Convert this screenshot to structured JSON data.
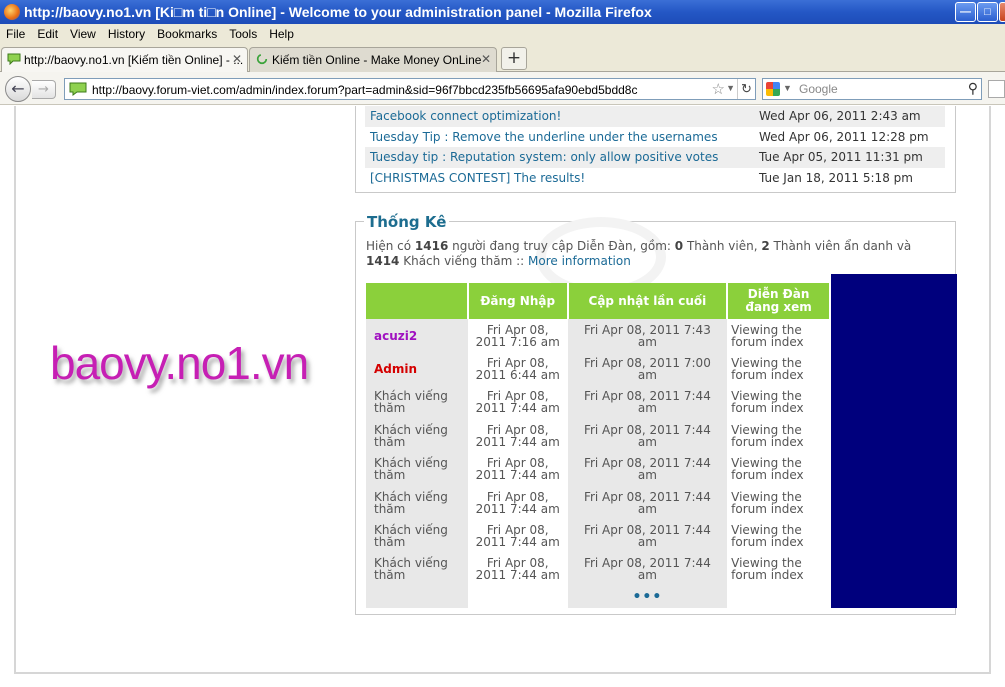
{
  "window": {
    "title": "http://baovy.no1.vn [Ki□m ti□n Online] - Welcome to your administration panel - Mozilla Firefox"
  },
  "menu": [
    "File",
    "Edit",
    "View",
    "History",
    "Bookmarks",
    "Tools",
    "Help"
  ],
  "tabs": [
    {
      "label": "http://baovy.no1.vn [Kiếm tiền Online] - ..."
    },
    {
      "label": "Kiếm tiền Online - Make Money OnLine"
    }
  ],
  "address": {
    "url": "http://baovy.forum-viet.com/admin/index.forum?part=admin&sid=96f7bbcd235fb56695afa90ebd5bdd8c"
  },
  "search": {
    "placeholder": "Google"
  },
  "news": [
    {
      "title": "Facebook connect optimization!",
      "date": "Wed Apr 06, 2011 2:43 am"
    },
    {
      "title": "Tuesday Tip : Remove the underline under the usernames",
      "date": "Wed Apr 06, 2011 12:28 pm"
    },
    {
      "title": "Tuesday tip : Reputation system: only allow positive votes",
      "date": "Tue Apr 05, 2011 11:31 pm"
    },
    {
      "title": "[CHRISTMAS CONTEST] The results!",
      "date": "Tue Jan 18, 2011 5:18 pm"
    }
  ],
  "watermark": "baovy.no1.vn",
  "stats": {
    "heading": "Thống Kê",
    "info": {
      "p1": "Hiện có ",
      "total": "1416",
      "p2": " người đang truy cập Diễn Đàn, gồm: ",
      "members": "0",
      "p3": " Thành viên, ",
      "hidden": "2",
      "p4": " Thành viên ẩn danh và ",
      "guests": "1414",
      "p5": " Khách viếng thăm :: ",
      "link": "More information"
    },
    "columns": [
      "",
      "Đăng Nhập",
      "Cập nhật lần cuối",
      "Diễn Đàn đang xem"
    ],
    "rows": [
      {
        "user": "acuzi2",
        "login": "Fri Apr 08, 2011 7:16 am",
        "last": "Fri Apr 08, 2011 7:43 am",
        "viewing": "Viewing the forum index"
      },
      {
        "user": "Admin",
        "login": "Fri Apr 08, 2011 6:44 am",
        "last": "Fri Apr 08, 2011 7:00 am",
        "viewing": "Viewing the forum index"
      },
      {
        "user": "Khách viếng thăm",
        "login": "Fri Apr 08, 2011 7:44 am",
        "last": "Fri Apr 08, 2011 7:44 am",
        "viewing": "Viewing the forum index"
      },
      {
        "user": "Khách viếng thăm",
        "login": "Fri Apr 08, 2011 7:44 am",
        "last": "Fri Apr 08, 2011 7:44 am",
        "viewing": "Viewing the forum index"
      },
      {
        "user": "Khách viếng thăm",
        "login": "Fri Apr 08, 2011 7:44 am",
        "last": "Fri Apr 08, 2011 7:44 am",
        "viewing": "Viewing the forum index"
      },
      {
        "user": "Khách viếng thăm",
        "login": "Fri Apr 08, 2011 7:44 am",
        "last": "Fri Apr 08, 2011 7:44 am",
        "viewing": "Viewing the forum index"
      },
      {
        "user": "Khách viếng thăm",
        "login": "Fri Apr 08, 2011 7:44 am",
        "last": "Fri Apr 08, 2011 7:44 am",
        "viewing": "Viewing the forum index"
      },
      {
        "user": "Khách viếng thăm",
        "login": "Fri Apr 08, 2011 7:44 am",
        "last": "Fri Apr 08, 2011 7:44 am",
        "viewing": "Viewing the forum index"
      }
    ],
    "more": "•••"
  },
  "colors": {
    "header_green": "#8bd03b",
    "user_acuzi2": "#a010c0",
    "user_admin": "#d40000",
    "link": "#1b6a96",
    "navy_box": "#00007d"
  }
}
